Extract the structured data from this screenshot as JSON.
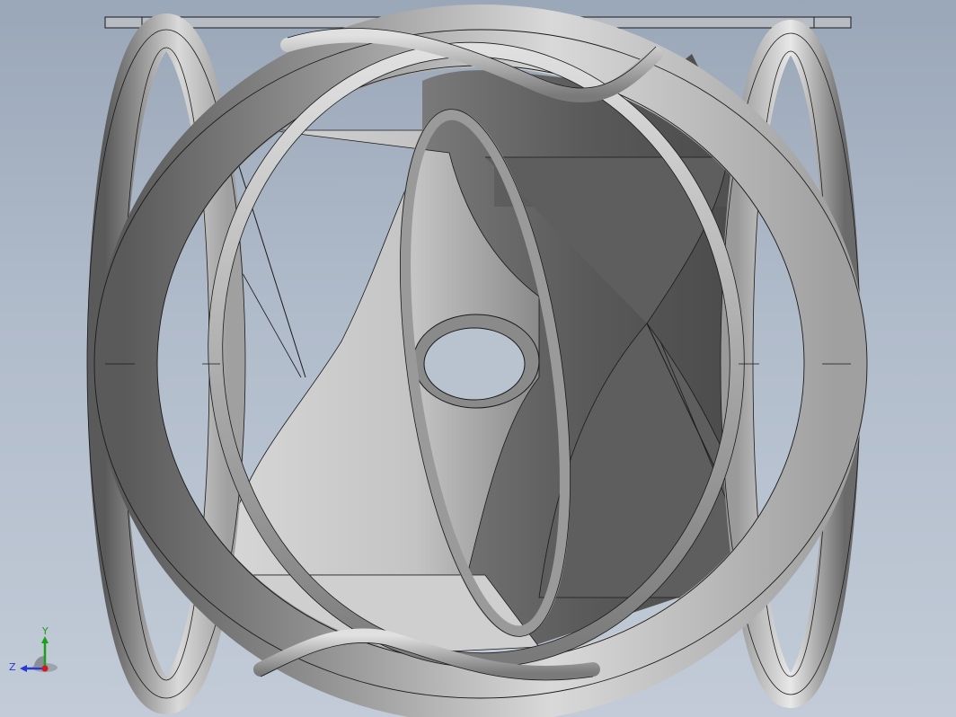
{
  "viewport": {
    "background_top": "#9aa7b8",
    "background_bottom": "#c2cbd7",
    "part_shade_light": "#e4e4e4",
    "part_shade_mid": "#a6a6a6",
    "part_shade_dark": "#4e4e4e",
    "edge_color": "#1a1a1a"
  },
  "triad": {
    "y_label": "Y",
    "z_label": "Z",
    "y_color": "#1aa01a",
    "z_color": "#2a3ad0",
    "x_color": "#d01a1a"
  }
}
